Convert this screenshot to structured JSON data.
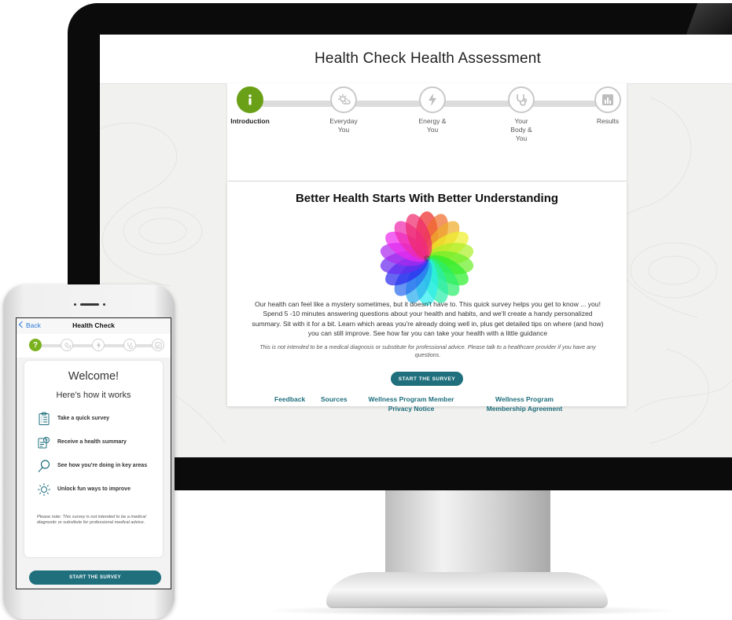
{
  "desktop": {
    "title": "Health Check Health Assessment",
    "steps": [
      {
        "label": "Introduction",
        "icon": "info-icon",
        "active": true
      },
      {
        "label": "Everyday You",
        "icon": "sun-cloud-icon",
        "active": false
      },
      {
        "label": "Energy & You",
        "icon": "lightning-icon",
        "active": false
      },
      {
        "label": "Your Body & You",
        "icon": "stethoscope-icon",
        "active": false
      },
      {
        "label": "Results",
        "icon": "chart-icon",
        "active": false
      }
    ],
    "heading": "Better Health Starts With Better Understanding",
    "intro": "Our health can feel like a mystery sometimes, but it doesn't have to. This quick survey helps you get to know ... you! Spend 5 -10 minutes answering questions about your health and habits, and we'll create a handy personalized summary. Sit with it for a bit. Learn which areas you're already doing well in, plus get detailed tips on where (and how) you can still improve. See how far you can take your health with a little guidance",
    "disclaimer": "This is not intended to be a medical diagnosis or substitute for professional advice. Please talk to a healthcare provider if you have any questions.",
    "start_button": "START THE SURVEY",
    "footer_links": [
      "Feedback",
      "Sources",
      "Wellness Program Member Privacy Notice",
      "Wellness Program Membership Agreement"
    ]
  },
  "mobile": {
    "back_label": "Back",
    "title": "Health Check",
    "active_step_symbol": "?",
    "welcome": "Welcome!",
    "how_it_works": "Here's how it works",
    "items": [
      {
        "icon": "clipboard-icon",
        "text": "Take a quick survey"
      },
      {
        "icon": "health-summary-icon",
        "text": "Receive a health summary"
      },
      {
        "icon": "magnifier-icon",
        "text": "See how you're doing in key areas"
      },
      {
        "icon": "sun-icon",
        "text": "Unlock fun ways to improve"
      }
    ],
    "note": "Please note: This survey is not intended to be a medical diagnostic or substitute for professional medical advice.",
    "start_button": "START THE SURVEY"
  },
  "colors": {
    "accent_green": "#6aa017",
    "accent_teal": "#1f6f7d",
    "ios_blue": "#2a7bd4"
  }
}
